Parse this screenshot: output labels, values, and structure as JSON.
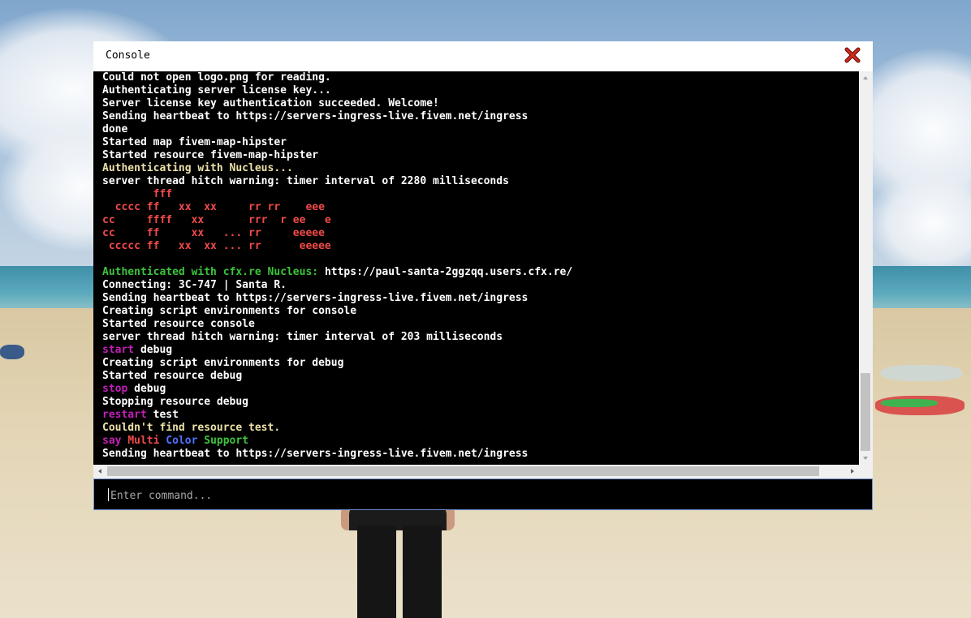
{
  "window": {
    "title": "Console"
  },
  "icons": {
    "close": "close-x-icon",
    "scroll_up": "arrow-up-icon",
    "scroll_down": "arrow-down-icon",
    "scroll_left": "arrow-left-icon",
    "scroll_right": "arrow-right-icon"
  },
  "colors": {
    "white": "#ffffff",
    "yellow": "#ece1a8",
    "red": "#f24a4a",
    "green": "#3cc43c",
    "magenta": "#c21fb6",
    "blue": "#5173ff",
    "close_icon": "#d42a1c",
    "input_border": "#6d8fd0"
  },
  "output_lines": [
    [
      {
        "t": "Could not open logo.png for reading.",
        "c": "white"
      }
    ],
    [
      {
        "t": "Authenticating server license key...",
        "c": "white"
      }
    ],
    [
      {
        "t": "Server license key authentication succeeded. Welcome!",
        "c": "white"
      }
    ],
    [
      {
        "t": "Sending heartbeat to https://servers-ingress-live.fivem.net/ingress",
        "c": "white"
      }
    ],
    [
      {
        "t": "done",
        "c": "white"
      }
    ],
    [
      {
        "t": "Started map fivem-map-hipster",
        "c": "white"
      }
    ],
    [
      {
        "t": "Started resource fivem-map-hipster",
        "c": "white"
      }
    ],
    [
      {
        "t": "Authenticating with Nucleus...",
        "c": "yellow"
      }
    ],
    [
      {
        "t": "server thread hitch warning: timer interval of 2280 milliseconds",
        "c": "white"
      }
    ],
    [
      {
        "t": "        fff",
        "c": "red"
      }
    ],
    [
      {
        "t": "  cccc ff   xx  xx     rr rr    eee",
        "c": "red"
      }
    ],
    [
      {
        "t": "cc     ffff   xx       rrr  r ee   e",
        "c": "red"
      }
    ],
    [
      {
        "t": "cc     ff     xx   ... rr     eeeee",
        "c": "red"
      }
    ],
    [
      {
        "t": " ccccc ff   xx  xx ... rr      eeeee",
        "c": "red"
      }
    ],
    [
      {
        "t": " ",
        "c": "white"
      }
    ],
    [
      {
        "t": "Authenticated with cfx.re Nucleus: ",
        "c": "green"
      },
      {
        "t": "https://paul-santa-2ggzqq.users.cfx.re/",
        "c": "white"
      }
    ],
    [
      {
        "t": "Connecting: 3C-747 | Santa R.",
        "c": "white"
      }
    ],
    [
      {
        "t": "Sending heartbeat to https://servers-ingress-live.fivem.net/ingress",
        "c": "white"
      }
    ],
    [
      {
        "t": "Creating script environments for console",
        "c": "white"
      }
    ],
    [
      {
        "t": "Started resource console",
        "c": "white"
      }
    ],
    [
      {
        "t": "server thread hitch warning: timer interval of 203 milliseconds",
        "c": "white"
      }
    ],
    [
      {
        "t": "start",
        "c": "magenta"
      },
      {
        "t": " debug",
        "c": "white"
      }
    ],
    [
      {
        "t": "Creating script environments for debug",
        "c": "white"
      }
    ],
    [
      {
        "t": "Started resource debug",
        "c": "white"
      }
    ],
    [
      {
        "t": "stop",
        "c": "magenta"
      },
      {
        "t": " debug",
        "c": "white"
      }
    ],
    [
      {
        "t": "Stopping resource debug",
        "c": "white"
      }
    ],
    [
      {
        "t": "restart",
        "c": "magenta"
      },
      {
        "t": " test",
        "c": "white"
      }
    ],
    [
      {
        "t": "Couldn't find resource test.",
        "c": "yellow"
      }
    ],
    [
      {
        "t": "say ",
        "c": "magenta"
      },
      {
        "t": "Multi ",
        "c": "red"
      },
      {
        "t": "Color ",
        "c": "blue"
      },
      {
        "t": "Support",
        "c": "green"
      }
    ],
    [
      {
        "t": "Sending heartbeat to https://servers-ingress-live.fivem.net/ingress",
        "c": "white"
      }
    ]
  ],
  "input": {
    "value": "",
    "placeholder": "Enter command..."
  }
}
